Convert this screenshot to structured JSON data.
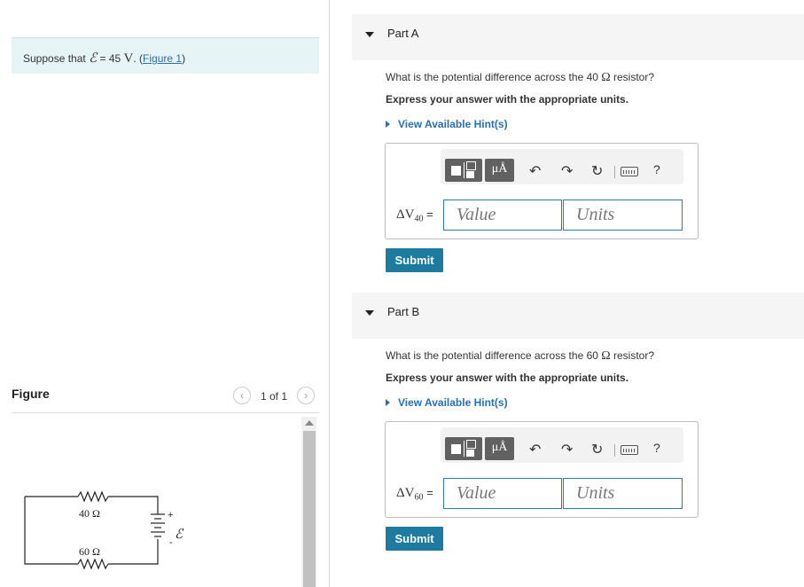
{
  "problem": {
    "prefix": "Suppose that ",
    "emf_symbol": "ℰ",
    "equals": " = 45 ",
    "unit": "V",
    "period": ". (",
    "figure_link": "Figure 1",
    "close": ")"
  },
  "figure": {
    "title": "Figure",
    "pager": "1 of 1",
    "prev_icon": "‹",
    "next_icon": "›",
    "resistor_top": "40 Ω",
    "resistor_bottom": "60 Ω",
    "battery_label": "ℰ",
    "plus": "+",
    "minus": "-"
  },
  "parts": [
    {
      "title": "Part A",
      "question_pre": "What is the potential difference across the 40 ",
      "omega": "Ω",
      "question_post": " resistor?",
      "instruction": "Express your answer with the appropriate units.",
      "hint": "View Available Hint(s)",
      "label_delta": "ΔV",
      "label_sub": "40",
      "label_eq": " =",
      "value_placeholder": "Value",
      "units_placeholder": "Units",
      "submit": "Submit"
    },
    {
      "title": "Part B",
      "question_pre": "What is the potential difference across the 60 ",
      "omega": "Ω",
      "question_post": " resistor?",
      "instruction": "Express your answer with the appropriate units.",
      "hint": "View Available Hint(s)",
      "label_delta": "ΔV",
      "label_sub": "60",
      "label_eq": " =",
      "value_placeholder": "Value",
      "units_placeholder": "Units",
      "submit": "Submit"
    }
  ],
  "toolbar": {
    "units_glyph": "μÅ",
    "undo_glyph": "↶",
    "redo_glyph": "↷",
    "reset_glyph": "↻",
    "help_glyph": "?"
  },
  "colors": {
    "accent": "#1d7ba0",
    "link": "#2a6fb0",
    "problem_bg": "#e6f4f5"
  }
}
